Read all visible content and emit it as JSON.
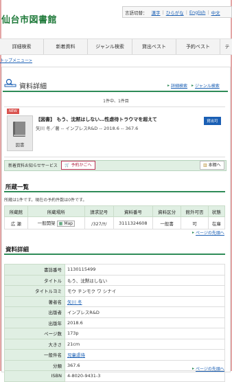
{
  "site": {
    "title": "仙台市図書館",
    "lang_label": "言語切替：",
    "languages": [
      "漢字",
      "ひらがな",
      "English",
      "中文"
    ]
  },
  "nav": [
    "詳細検索",
    "新着資料",
    "ジャンル検索",
    "貸出ベスト",
    "予約ベスト",
    "テ"
  ],
  "breadcrumb": "トップメニュー>",
  "page": {
    "title": "資料詳細",
    "link_advanced": "詳細検索",
    "link_genre": "ジャンル検索",
    "count": "1件中、1件目"
  },
  "record": {
    "badge_new": "NEW",
    "cover_label": "図書",
    "title": "【図書】 もう、沈黙はしない…性虐待トラウマを超えて",
    "subtitle": "矢川 冬／著 -- インプレスR&D -- 2018.6 -- 367.6",
    "status_badge": "貸出可"
  },
  "services": {
    "alert_label": "新着資料お知らせサービス",
    "cart_button": "予約かごへ",
    "shelf_button": "本棚へ"
  },
  "holdings": {
    "title": "所蔵一覧",
    "note": "所蔵は1件です。現在の予約件数は0件です。",
    "headers": [
      "所蔵館",
      "所蔵場所",
      "請求記号",
      "資料番号",
      "資料区分",
      "館外可否",
      "状態"
    ],
    "rows": [
      {
        "library": "広 瀬",
        "location": "一般開架",
        "map": "Map",
        "call_no": "/327/ﾔ/",
        "item_no": "3111324608",
        "category": "一般書",
        "lendable": "可",
        "status": "在庫"
      }
    ],
    "pagetop": "ページの先頭へ"
  },
  "details": {
    "title": "資料詳細",
    "rows": [
      {
        "label": "書誌番号",
        "value": "1130115499",
        "link": false
      },
      {
        "label": "タイトル",
        "value": "もう、沈黙はしない",
        "link": false
      },
      {
        "label": "タイトルヨミ",
        "value": "モウ チンモク ワ シナイ",
        "link": false
      },
      {
        "label": "著者名",
        "value": "矢川 冬",
        "link": true
      },
      {
        "label": "出版者",
        "value": "インプレスR&D",
        "link": false
      },
      {
        "label": "出版年",
        "value": "2018.6",
        "link": false
      },
      {
        "label": "ページ数",
        "value": "173p",
        "link": false
      },
      {
        "label": "大きさ",
        "value": "21cm",
        "link": false
      },
      {
        "label": "一般件名",
        "value": "児童虐待",
        "link": true
      },
      {
        "label": "分類",
        "value": "367.6",
        "link": false
      },
      {
        "label": "ISBN",
        "value": "4-8020-9431-3",
        "link": false
      }
    ],
    "pagetop": "ページの先頭へ"
  }
}
